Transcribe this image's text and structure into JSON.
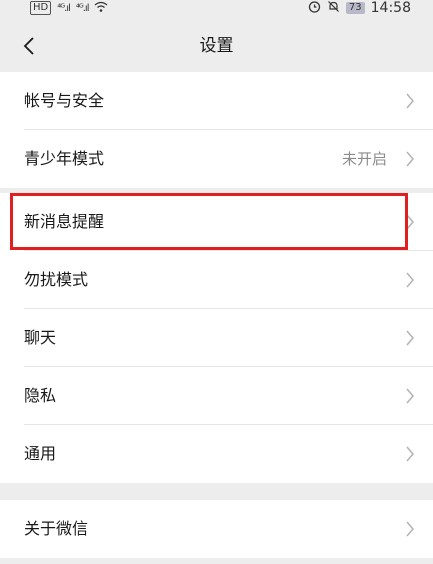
{
  "status_bar": {
    "left_badge": "HD",
    "signal_1": "⁴ᴳ.ıl",
    "signal_2": "⁴ᴳ.ıl",
    "wifi": "wifi",
    "battery": "73",
    "time": "14:58"
  },
  "nav": {
    "title": "设置"
  },
  "groups": [
    {
      "items": [
        {
          "label": "帐号与安全",
          "value": ""
        },
        {
          "label": "青少年模式",
          "value": "未开启"
        }
      ]
    },
    {
      "items": [
        {
          "label": "新消息提醒",
          "value": "",
          "highlighted": true
        },
        {
          "label": "勿扰模式",
          "value": ""
        },
        {
          "label": "聊天",
          "value": ""
        },
        {
          "label": "隐私",
          "value": ""
        },
        {
          "label": "通用",
          "value": ""
        }
      ]
    },
    {
      "items": [
        {
          "label": "关于微信",
          "value": ""
        }
      ]
    }
  ],
  "colors": {
    "background": "#ededed",
    "cell": "#ffffff",
    "highlight": "#e02020",
    "secondary_text": "#8c8c8c"
  },
  "icons": [
    "back-arrow-icon",
    "chevron-right-icon",
    "wifi-icon",
    "alarm-icon",
    "mute-icon",
    "battery-icon"
  ]
}
